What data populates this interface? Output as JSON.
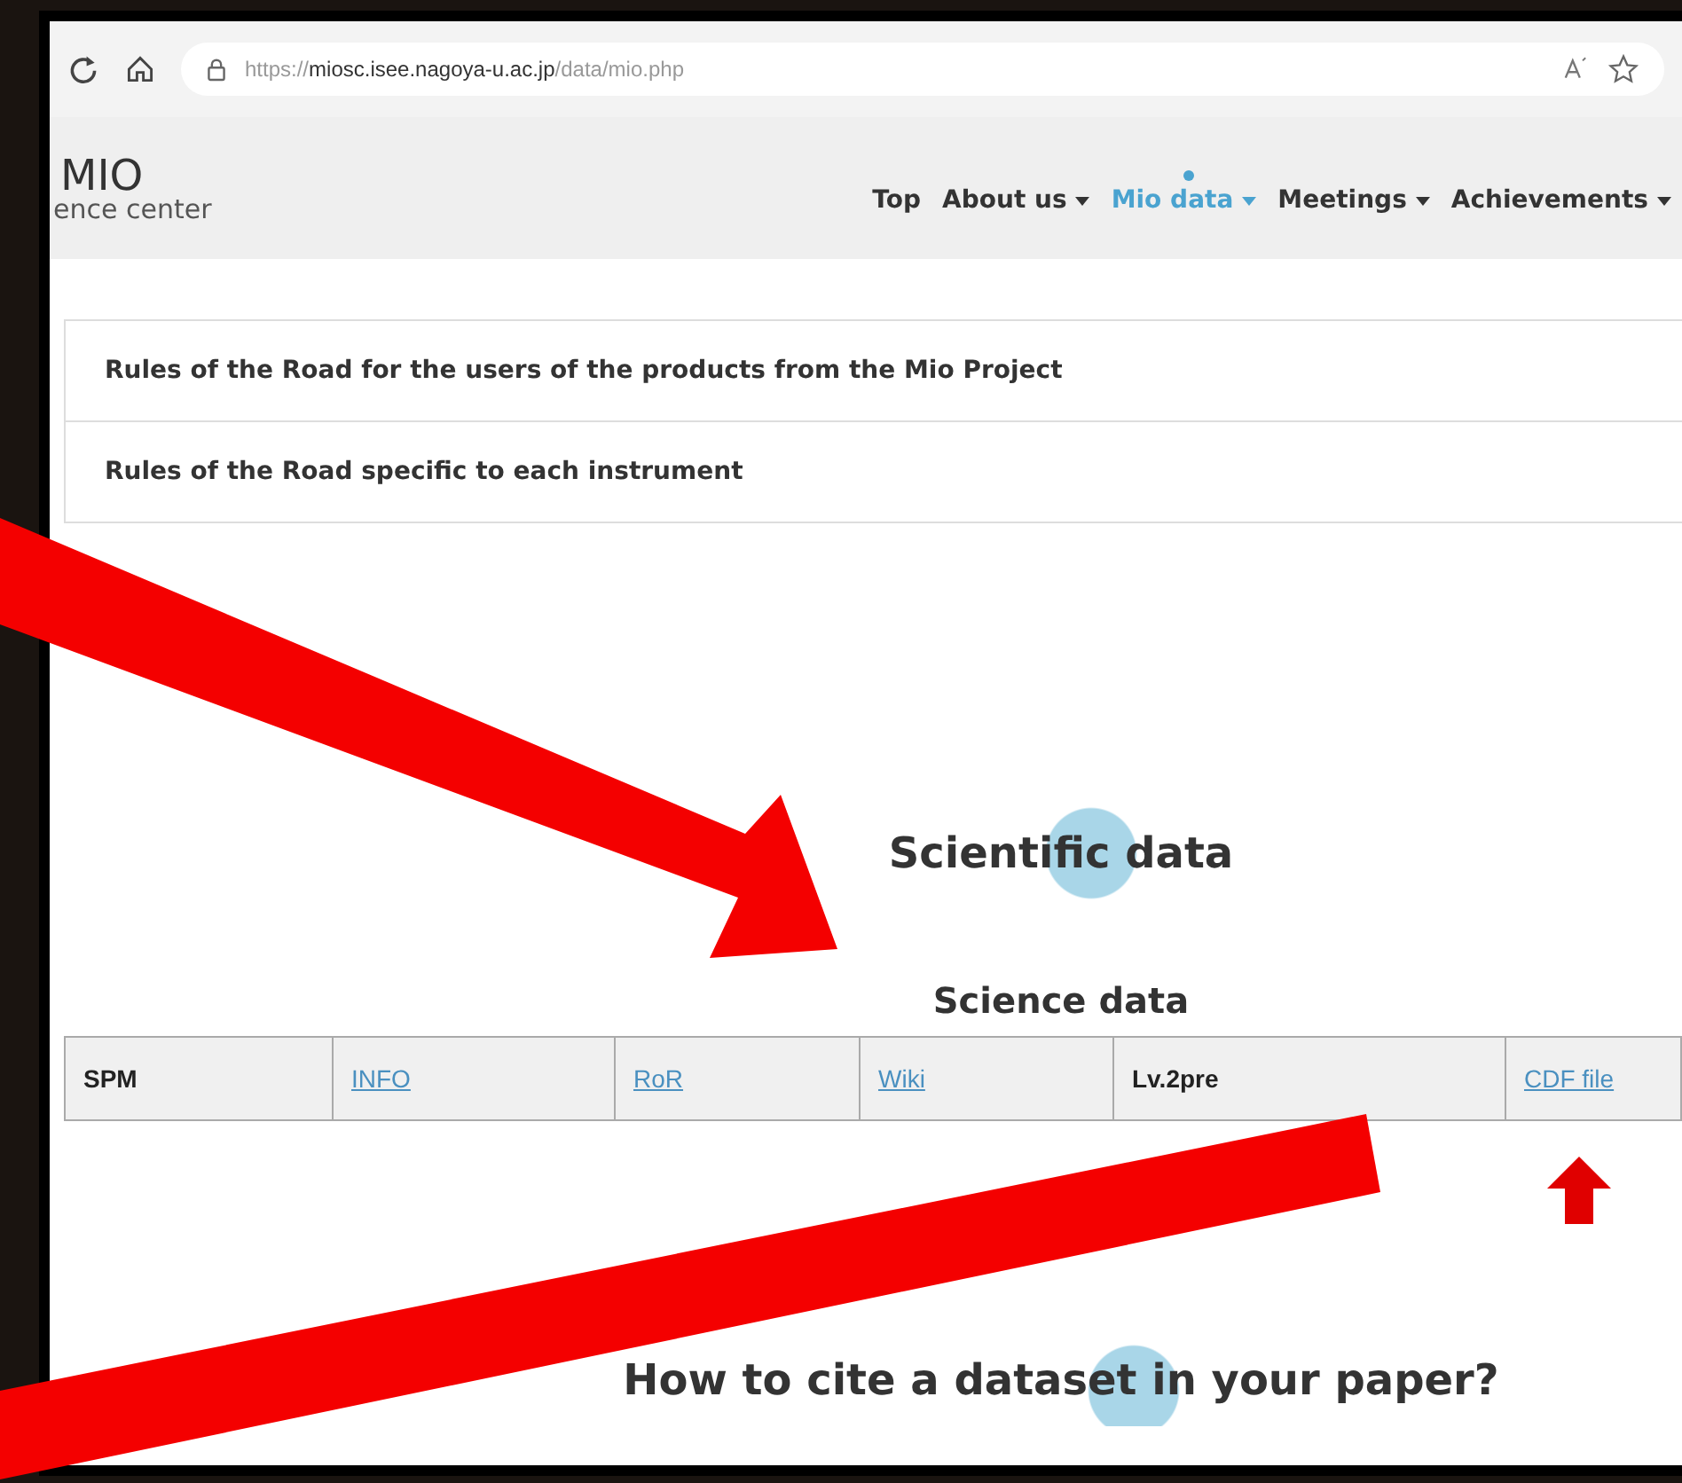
{
  "browser": {
    "url": "https://**miosc.isee.nagoya-u.ac.jp**/data/mio.php"
  },
  "site": {
    "logo": "MIO",
    "tagline": "ence center",
    "nav": [
      {
        "label": "Top",
        "selected": false,
        "menu": false
      },
      {
        "label": "About us",
        "selected": false,
        "menu": true
      },
      {
        "label": "Mio data",
        "selected": true,
        "menu": true
      },
      {
        "label": "Meetings",
        "selected": false,
        "menu": true
      },
      {
        "label": "Achievements",
        "selected": false,
        "menu": true
      }
    ]
  },
  "accordion": [
    {
      "label": "Rules of the Road for the users of the products from the Mio Project"
    },
    {
      "label": "Rules of the Road specific to each instrument"
    }
  ],
  "section_title": "Scientific data",
  "table_title": "Science data",
  "table_row": [
    {
      "text": "SPM",
      "kind": "text"
    },
    {
      "text": "INFO",
      "kind": "link"
    },
    {
      "text": "RoR",
      "kind": "link"
    },
    {
      "text": "Wiki",
      "kind": "link"
    },
    {
      "text": "Lv.2pre",
      "kind": "text"
    },
    {
      "text": "CDF file",
      "kind": "link"
    }
  ],
  "next_title": "How to cite a dataset in your paper?"
}
